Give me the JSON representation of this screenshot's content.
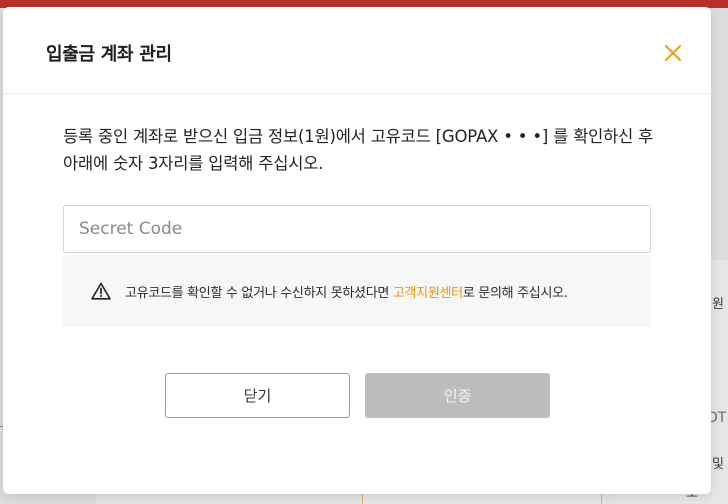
{
  "modal": {
    "title": "입출금 계좌 관리",
    "close_icon": "close-icon",
    "accent_color": "#f0a020",
    "instructions": "등록 중인 계좌로 받으신 입금 정보(1원)에서 고유코드 [GOPAX • • •] 를 확인하신 후 아래에 숫자 3자리를 입력해 주십시오.",
    "code_input": {
      "placeholder": "Secret Code",
      "value": ""
    },
    "notice": {
      "icon": "warning-icon",
      "text_before": "고유코드를 확인할 수 없거나 수신하지 못하셨다면 ",
      "link_text": "고객지원센터",
      "text_after": "로 문의해 주십시오."
    },
    "buttons": {
      "close_label": "닫기",
      "verify_label": "인증",
      "verify_disabled": true
    }
  },
  "background": {
    "topbar_color": "#b8322d",
    "right_texts": [
      "원",
      "DT",
      "및",
      "도"
    ]
  }
}
